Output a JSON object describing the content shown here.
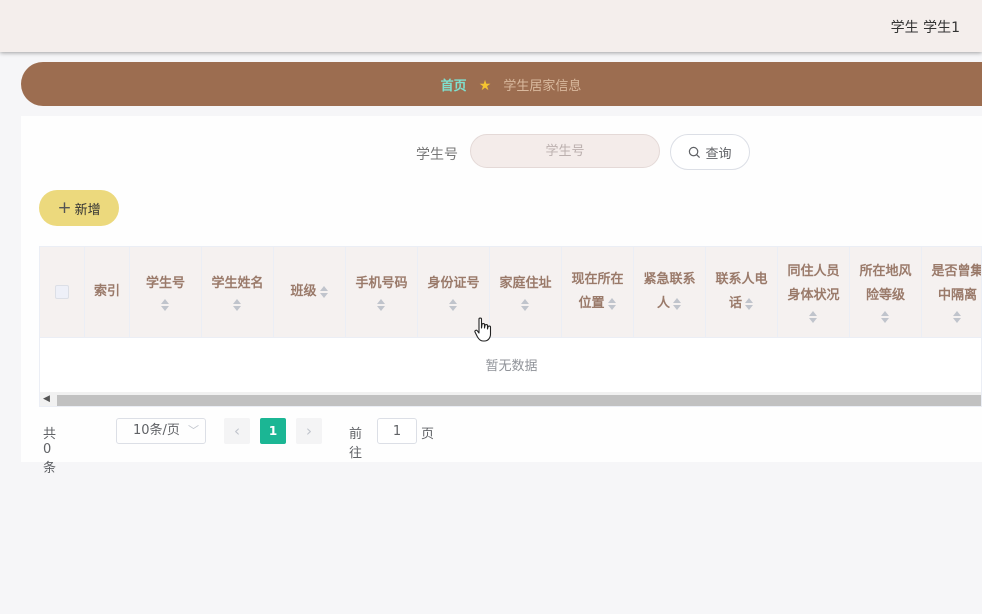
{
  "header": {
    "user_label": "学生 学生1"
  },
  "breadcrumb": {
    "home": "首页",
    "current": "学生居家信息",
    "separator_icon": "star-icon"
  },
  "search": {
    "label": "学生号",
    "placeholder": "学生号",
    "query_label": "查询"
  },
  "toolbar": {
    "add_label": "新增"
  },
  "table": {
    "columns": [
      {
        "label": "索引",
        "sortable": false
      },
      {
        "label": "学生号",
        "sortable": true
      },
      {
        "label": "学生姓名",
        "sortable": true
      },
      {
        "label": "班级",
        "sortable": true
      },
      {
        "label": "手机号码",
        "sortable": true
      },
      {
        "label": "身份证号",
        "sortable": true
      },
      {
        "label": "家庭住址",
        "sortable": true
      },
      {
        "label": "现在所在位置",
        "sortable": true
      },
      {
        "label": "紧急联系人",
        "sortable": true
      },
      {
        "label": "联系人电话",
        "sortable": true
      },
      {
        "label": "同住人员身体状况",
        "sortable": true
      },
      {
        "label": "所在地风险等级",
        "sortable": true
      },
      {
        "label": "是否曾集中隔离",
        "sortable": true
      }
    ],
    "header_lines": {
      "c0": "索引",
      "c1": "学生号",
      "c2": "学生姓名",
      "c3": "班级",
      "c4": "手机号码",
      "c5": "身份证号",
      "c6": "家庭住址",
      "c7a": "现在所在",
      "c7b": "位置",
      "c8a": "紧急联系",
      "c8b": "人",
      "c9a": "联系人电",
      "c9b": "话",
      "c10a": "同住人员",
      "c10b": "身体状况",
      "c11a": "所在地风",
      "c11b": "险等级",
      "c12a": "是否曾集",
      "c12b": "中隔离"
    },
    "empty_text": "暂无数据"
  },
  "pagination": {
    "total_text": "共 0 条",
    "page_size": "10条/页",
    "current_page": "1",
    "goto_label": "前往",
    "goto_value": "1",
    "goto_suffix": "页"
  },
  "colors": {
    "topbar": "#f4eeec",
    "breadcrumb_bar": "#9c6d50",
    "add_button": "#ecd97d",
    "active_page": "#1bb694"
  }
}
